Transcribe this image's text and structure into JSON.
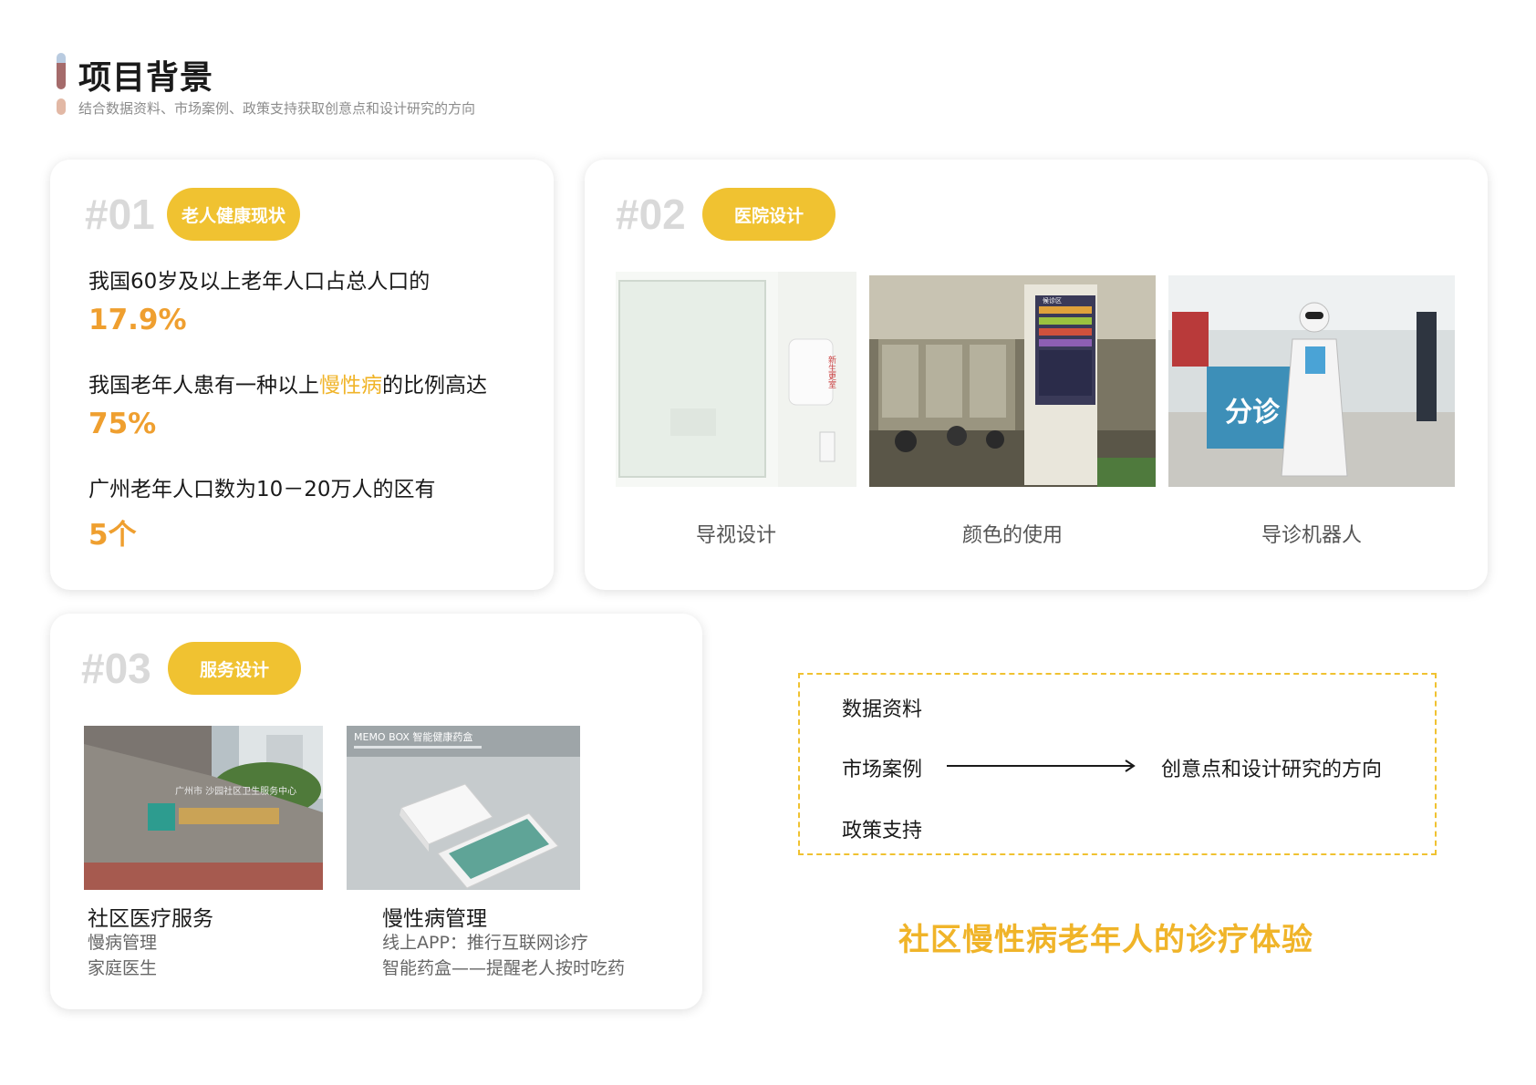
{
  "header": {
    "title": "项目背景",
    "subtitle": "结合数据资料、市场案例、政策支持获取创意点和设计研究的方向"
  },
  "section1": {
    "number": "#01",
    "tag": "老人健康现状",
    "stats": [
      {
        "text": "我国60岁及以上老年人口占总人口的",
        "value": "17.9%"
      },
      {
        "text_before": "我国老年人患有一种以上",
        "highlight": "慢性病",
        "text_after": "的比例高达",
        "value": "75%"
      },
      {
        "text": "广州老年人口数为10－20万人的区有",
        "value": "5个"
      }
    ]
  },
  "section2": {
    "number": "#02",
    "tag": "医院设计",
    "items": [
      {
        "caption": "导视设计",
        "sign": "新生更室"
      },
      {
        "caption": "颜色的使用",
        "sign": "候诊区"
      },
      {
        "caption": "导诊机器人",
        "sign": "分诊"
      }
    ]
  },
  "section3": {
    "number": "#03",
    "tag": "服务设计",
    "items": [
      {
        "title": "社区医疗服务",
        "lines": [
          "慢病管理",
          "家庭医生"
        ],
        "sign": "广州市 沙园社区卫生服务中心"
      },
      {
        "title": "慢性病管理",
        "lines": [
          "线上APP：推行互联网诊疗",
          "智能药盒——提醒老人按时吃药"
        ],
        "sign": "MEMO BOX 智能健康药盒"
      }
    ]
  },
  "flow": {
    "sources": [
      "数据资料",
      "市场案例",
      "政策支持"
    ],
    "target": "创意点和设计研究的方向"
  },
  "conclusion": "社区慢性病老年人的诊疗体验",
  "colors": {
    "accent": "#f0c231",
    "stat": "#ef9f2f",
    "number": "#d9d9d9"
  }
}
